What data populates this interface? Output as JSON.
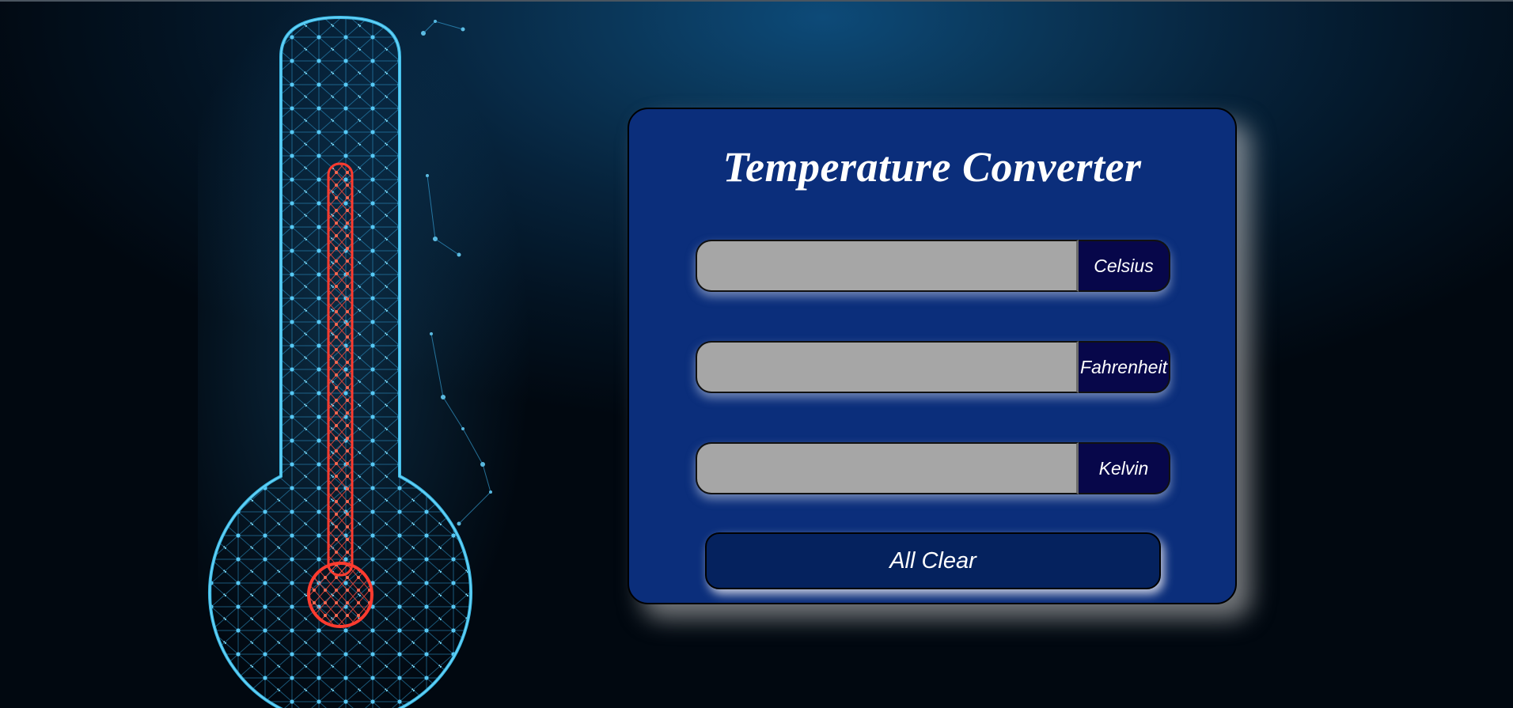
{
  "app": {
    "title": "Temperature Converter"
  },
  "fields": [
    {
      "unit": "Celsius",
      "value": ""
    },
    {
      "unit": "Fahrenheit",
      "value": ""
    },
    {
      "unit": "Kelvin",
      "value": ""
    }
  ],
  "actions": {
    "clear_label": "All Clear"
  },
  "colors": {
    "card_background": "#0b2e7b",
    "input_background": "#a6a6a6",
    "unit_label_background": "#07074a",
    "button_background": "#05225e",
    "thermometer_outline": "#37b6e8",
    "thermometer_mercury": "#e0302a"
  },
  "decorations": {
    "background_art": "wireframe-thermometer-icon"
  }
}
